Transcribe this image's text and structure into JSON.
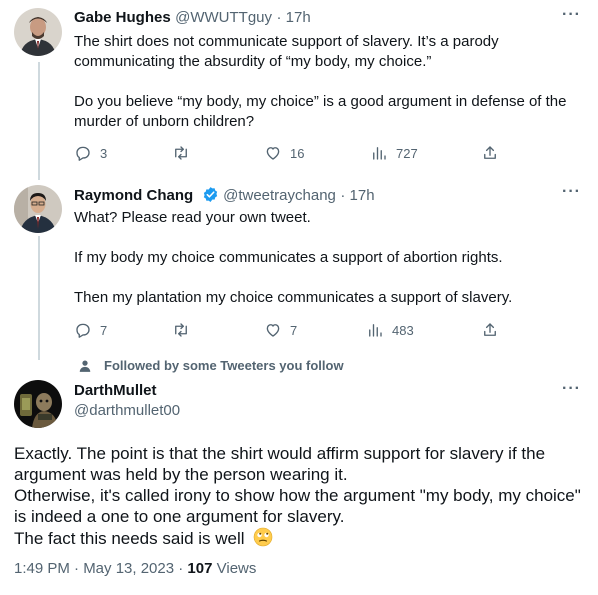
{
  "tweets": [
    {
      "name": "Gabe Hughes",
      "handle": "@WWUTTguy",
      "time": "· 17h",
      "text": "The shirt does not communicate support of slavery. It’s a parody communicating the absurdity of “my body, my choice.”\n\nDo you believe “my body, my choice” is a good argument in defense of the murder of unborn children?",
      "replies": "3",
      "likes": "16",
      "views": "727"
    },
    {
      "name": "Raymond Chang",
      "handle": "@tweetraychang",
      "time": "· 17h",
      "verified": true,
      "text": "What? Please read your own tweet.\n\nIf my body my choice communicates a support of abortion rights.\n\nThen my plantation my choice communicates a support of slavery.",
      "replies": "7",
      "likes": "7",
      "views": "483"
    }
  ],
  "social_context": "Followed by some Tweeters you follow",
  "main_tweet": {
    "name": "DarthMullet",
    "handle": "@darthmullet00",
    "text": "Exactly. The point is that the shirt would affirm support for slavery if the argument was held by the person wearing it.\nOtherwise, it's called irony to show how the argument \"my body, my choice\" is indeed a one to one argument for slavery.\nThe fact this needs said is well",
    "emoji": "🙄",
    "timestamp": "1:49 PM · May 13, 2023 ·",
    "views_count": "107",
    "views_label": "Views"
  },
  "colors": {
    "verified": "#1d9bf0",
    "thread_line": "#cfd9de",
    "muted": "#536471"
  }
}
